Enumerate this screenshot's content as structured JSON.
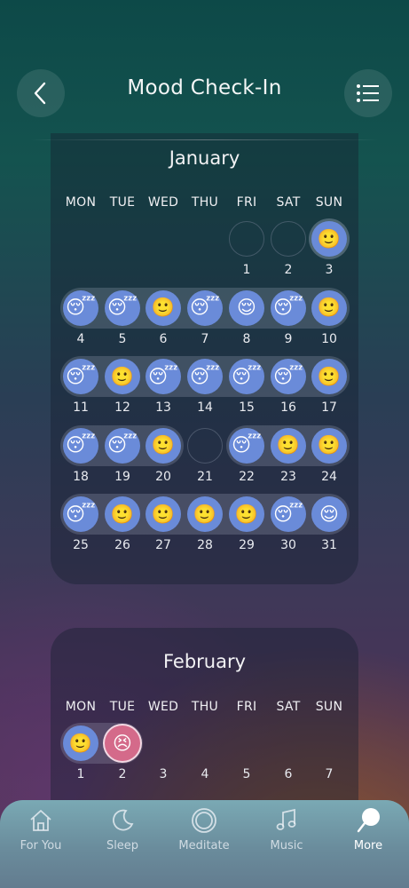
{
  "header": {
    "title": "Mood Check-In",
    "back_icon": "chevron-left-icon",
    "list_icon": "list-icon"
  },
  "weekdays": [
    "MON",
    "TUE",
    "WED",
    "THU",
    "FRI",
    "SAT",
    "SUN"
  ],
  "months": [
    {
      "name": "January",
      "weeks": [
        [
          {
            "day": "",
            "mood": null
          },
          {
            "day": "",
            "mood": null
          },
          {
            "day": "",
            "mood": null
          },
          {
            "day": "",
            "mood": null
          },
          {
            "day": "1",
            "mood": "none"
          },
          {
            "day": "2",
            "mood": "none"
          },
          {
            "day": "3",
            "mood": "happy"
          }
        ],
        [
          {
            "day": "4",
            "mood": "sleepy"
          },
          {
            "day": "5",
            "mood": "sleepy"
          },
          {
            "day": "6",
            "mood": "happy"
          },
          {
            "day": "7",
            "mood": "sleepy"
          },
          {
            "day": "8",
            "mood": "relieved"
          },
          {
            "day": "9",
            "mood": "sleepy"
          },
          {
            "day": "10",
            "mood": "happy"
          }
        ],
        [
          {
            "day": "11",
            "mood": "sleepy"
          },
          {
            "day": "12",
            "mood": "happy"
          },
          {
            "day": "13",
            "mood": "sleepy"
          },
          {
            "day": "14",
            "mood": "sleepy"
          },
          {
            "day": "15",
            "mood": "sleepy"
          },
          {
            "day": "16",
            "mood": "sleepy"
          },
          {
            "day": "17",
            "mood": "happy"
          }
        ],
        [
          {
            "day": "18",
            "mood": "sleepy"
          },
          {
            "day": "19",
            "mood": "sleepy"
          },
          {
            "day": "20",
            "mood": "happy"
          },
          {
            "day": "21",
            "mood": "none"
          },
          {
            "day": "22",
            "mood": "sleepy"
          },
          {
            "day": "23",
            "mood": "happy"
          },
          {
            "day": "24",
            "mood": "happy"
          }
        ],
        [
          {
            "day": "25",
            "mood": "sleepy"
          },
          {
            "day": "26",
            "mood": "happy"
          },
          {
            "day": "27",
            "mood": "happy"
          },
          {
            "day": "28",
            "mood": "happy"
          },
          {
            "day": "29",
            "mood": "happy"
          },
          {
            "day": "30",
            "mood": "sleepy"
          },
          {
            "day": "31",
            "mood": "relieved"
          }
        ]
      ]
    },
    {
      "name": "February",
      "weeks": [
        [
          {
            "day": "1",
            "mood": "happy"
          },
          {
            "day": "2",
            "mood": "confounded"
          },
          {
            "day": "3",
            "mood": null
          },
          {
            "day": "4",
            "mood": null
          },
          {
            "day": "5",
            "mood": null
          },
          {
            "day": "6",
            "mood": null
          },
          {
            "day": "7",
            "mood": null
          }
        ]
      ]
    }
  ],
  "mood_glyphs": {
    "happy": "🙂",
    "sleepy": "😴",
    "relieved": "😌",
    "confounded": "😣"
  },
  "colors": {
    "logged_day": "#6a8bd9",
    "bad_day": "#d46a8a",
    "tabbar": "#7aa9b4"
  },
  "tabs": [
    {
      "label": "For You",
      "icon": "house-icon",
      "active": false
    },
    {
      "label": "Sleep",
      "icon": "moon-icon",
      "active": false
    },
    {
      "label": "Meditate",
      "icon": "circle-icon",
      "active": false
    },
    {
      "label": "Music",
      "icon": "music-note-icon",
      "active": false
    },
    {
      "label": "More",
      "icon": "search-bubble-icon",
      "active": true
    }
  ]
}
